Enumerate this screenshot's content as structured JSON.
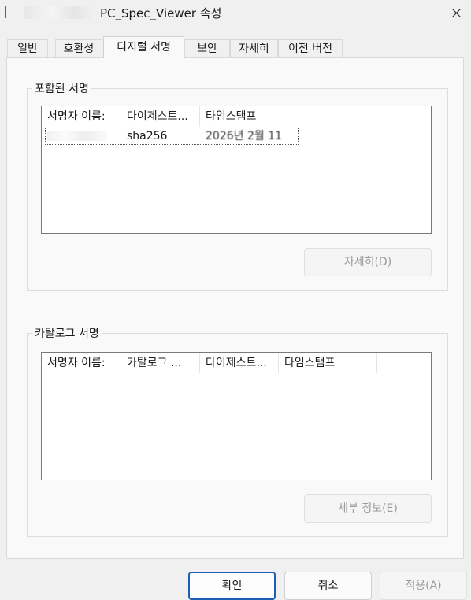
{
  "window": {
    "title": "PC_Spec_Viewer 속성"
  },
  "tabs": [
    {
      "label": "일반"
    },
    {
      "label": "호환성"
    },
    {
      "label": "디지털 서명"
    },
    {
      "label": "보안"
    },
    {
      "label": "자세히"
    },
    {
      "label": "이전 버전"
    }
  ],
  "active_tab": "디지털 서명",
  "embedded_signatures": {
    "title": "포함된 서명",
    "columns": [
      "서명자 이름:",
      "다이제스트...",
      "타임스탬프"
    ],
    "rows": [
      {
        "signer": "",
        "digest": "sha256",
        "timestamp": "2026년 2월 11"
      }
    ],
    "details_button": "자세히(D)"
  },
  "catalog_signatures": {
    "title": "카탈로그 서명",
    "columns": [
      "서명자 이름:",
      "카탈로그 ...",
      "다이제스트...",
      "타임스탬프"
    ],
    "rows": [],
    "details_button": "세부 정보(E)"
  },
  "footer": {
    "ok": "확인",
    "cancel": "취소",
    "apply": "적용(A)"
  },
  "colors": {
    "accent": "#1c5db5",
    "disabled_text": "#9b9b9b"
  }
}
